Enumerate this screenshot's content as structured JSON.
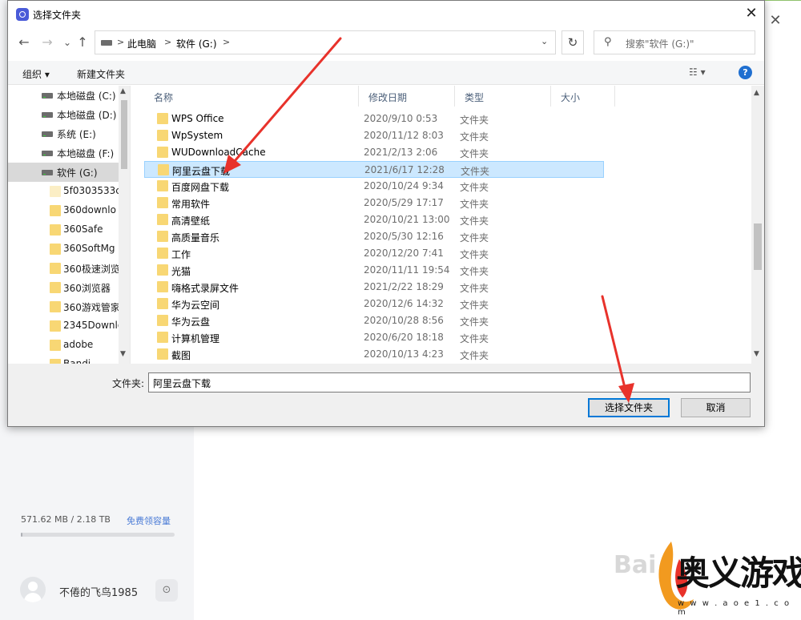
{
  "background_app": {
    "storage_text": "571.62 MB / 2.18 TB",
    "storage_fraction": 0.0003,
    "storage_link": "免费领容量",
    "user_name": "不倦的飞鸟1985",
    "close_glyph": "✕",
    "settings_glyph": "⊙"
  },
  "watermark": {
    "brand": "奥义游戏网",
    "url": "w w w . a o e 1 . c o m",
    "faint_text": "Bai"
  },
  "dialog": {
    "title": "选择文件夹",
    "close_glyph": "✕",
    "nav": {
      "back": "←",
      "forward": "→",
      "recent": "⌄",
      "up": "↑"
    },
    "address": {
      "seg1": "此电脑",
      "seg2": "软件 (G:)",
      "sep": ">",
      "dropdown": "⌄"
    },
    "refresh_glyph": "↻",
    "search_placeholder": "搜索\"软件 (G:)\"",
    "search_glyph": "⚲",
    "toolbar": {
      "organize": "组织 ▾",
      "new_folder": "新建文件夹",
      "view": "☷ ▾",
      "help": "?"
    },
    "tree": [
      {
        "label": "本地磁盘 (C:)",
        "kind": "drive"
      },
      {
        "label": "本地磁盘 (D:)",
        "kind": "drive"
      },
      {
        "label": "系统 (E:)",
        "kind": "drive"
      },
      {
        "label": "本地磁盘 (F:)",
        "kind": "drive"
      },
      {
        "label": "软件 (G:)",
        "kind": "drive",
        "selected": true
      },
      {
        "label": "5f0303533c",
        "kind": "folder-pale"
      },
      {
        "label": "360downlo",
        "kind": "folder"
      },
      {
        "label": "360Safe",
        "kind": "folder"
      },
      {
        "label": "360SoftMg",
        "kind": "folder"
      },
      {
        "label": "360极速浏览",
        "kind": "folder"
      },
      {
        "label": "360浏览器",
        "kind": "folder"
      },
      {
        "label": "360游戏管家",
        "kind": "folder"
      },
      {
        "label": "2345Downlo",
        "kind": "folder"
      },
      {
        "label": "adobe",
        "kind": "folder"
      },
      {
        "label": "Bandi",
        "kind": "folder"
      }
    ],
    "columns": {
      "name": "名称",
      "date": "修改日期",
      "type": "类型",
      "size": "大小"
    },
    "rows": [
      {
        "name": "WPS Office",
        "date": "2020/9/10 0:53",
        "type": "文件夹"
      },
      {
        "name": "WpSystem",
        "date": "2020/11/12 8:03",
        "type": "文件夹"
      },
      {
        "name": "WUDownloadCache",
        "date": "2021/2/13 2:06",
        "type": "文件夹"
      },
      {
        "name": "阿里云盘下载",
        "date": "2021/6/17 12:28",
        "type": "文件夹",
        "selected": true
      },
      {
        "name": "百度网盘下载",
        "date": "2020/10/24 9:34",
        "type": "文件夹"
      },
      {
        "name": "常用软件",
        "date": "2020/5/29 17:17",
        "type": "文件夹"
      },
      {
        "name": "高清壁纸",
        "date": "2020/10/21 13:00",
        "type": "文件夹"
      },
      {
        "name": "高质量音乐",
        "date": "2020/5/30 12:16",
        "type": "文件夹"
      },
      {
        "name": "工作",
        "date": "2020/12/20 7:41",
        "type": "文件夹"
      },
      {
        "name": "光猫",
        "date": "2020/11/11 19:54",
        "type": "文件夹"
      },
      {
        "name": "嗨格式录屏文件",
        "date": "2021/2/22 18:29",
        "type": "文件夹"
      },
      {
        "name": "华为云空间",
        "date": "2020/12/6 14:32",
        "type": "文件夹"
      },
      {
        "name": "华为云盘",
        "date": "2020/10/28 8:56",
        "type": "文件夹"
      },
      {
        "name": "计算机管理",
        "date": "2020/6/20 18:18",
        "type": "文件夹"
      },
      {
        "name": "截图",
        "date": "2020/10/13 4:23",
        "type": "文件夹"
      }
    ],
    "folder_label": "文件夹:",
    "folder_value": "阿里云盘下载",
    "select_button": "选择文件夹",
    "cancel_button": "取消",
    "scroll_up": "▲",
    "scroll_down": "▼"
  },
  "colors": {
    "selection": "#cce8ff",
    "selection_border": "#99d1ff",
    "folder": "#f8d774",
    "accent": "#0078d7",
    "arrow": "#e8322b"
  }
}
